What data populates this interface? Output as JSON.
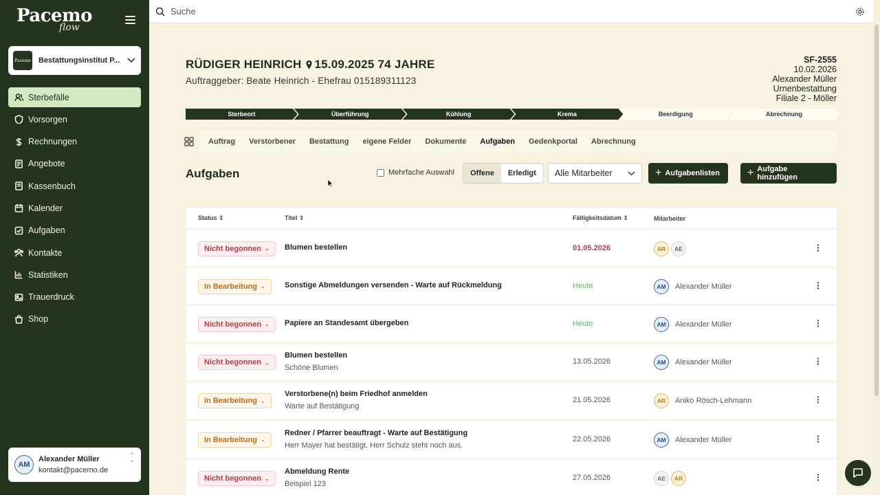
{
  "sidebar": {
    "brand": "Pacemo",
    "brand_sub": "flow",
    "org_logo": "Pacemo",
    "org_name": "Bestattungsinstitut P...",
    "items": [
      {
        "label": "Sterbefälle",
        "icon": "users-icon",
        "active": true
      },
      {
        "label": "Vorsorgen",
        "icon": "shield-icon"
      },
      {
        "label": "Rechnungen",
        "icon": "dollar-icon"
      },
      {
        "label": "Angebote",
        "icon": "document-icon"
      },
      {
        "label": "Kassenbuch",
        "icon": "book-icon"
      },
      {
        "label": "Kalender",
        "icon": "calendar-icon"
      },
      {
        "label": "Aufgaben",
        "icon": "checkbox-icon"
      },
      {
        "label": "Kontakte",
        "icon": "contacts-icon"
      },
      {
        "label": "Statistiken",
        "icon": "chart-icon"
      },
      {
        "label": "Trauerdruck",
        "icon": "image-icon"
      },
      {
        "label": "Shop",
        "icon": "shopping-bag-icon"
      }
    ],
    "user": {
      "initials": "AM",
      "name": "Alexander Müller",
      "email": "kontakt@pacemo.de"
    }
  },
  "search": {
    "placeholder": "Suche"
  },
  "case": {
    "name": "RÜDIGER HEINRICH",
    "date_age": "15.09.2025 74 JAHRE",
    "client": "Auftraggeber: Beate Heinrich - Ehefrau  015189311123",
    "id": "SF-2555",
    "date": "10.02.2026",
    "agent": "Alexander Müller",
    "type": "Urnenbestattung",
    "branch": "Filiale 2 - Möller"
  },
  "progress": [
    {
      "label": "Sterbeort",
      "done": true
    },
    {
      "label": "Überführung",
      "done": true
    },
    {
      "label": "Kühlung",
      "done": true
    },
    {
      "label": "Krema",
      "done": true
    },
    {
      "label": "Beerdigung",
      "done": false
    },
    {
      "label": "Abrechnung",
      "done": false
    }
  ],
  "tabs": [
    "Auftrag",
    "Verstorbener",
    "Bestattung",
    "eigene Felder",
    "Dokumente",
    "Aufgaben",
    "Gedenkportal",
    "Abrechnung"
  ],
  "active_tab": "Aufgaben",
  "tasks_section": {
    "title": "Aufgaben",
    "multi_select": "Mehrfache Auswahl",
    "filter_open": "Offene",
    "filter_done": "Erledigt",
    "staff_filter": "Alle Mitarbeiter",
    "btn_lists": "Aufgabenlisten",
    "btn_add": "Aufgabe hinzufügen"
  },
  "table": {
    "headers": {
      "status": "Status",
      "title": "Titel",
      "due": "Fälligkeitsdatum",
      "staff": "Mitarbeiter"
    },
    "rows": [
      {
        "status": "Nicht begonnen",
        "status_kind": "nb",
        "title": "Blumen bestellen",
        "desc": "",
        "due": "01.05.2026",
        "due_kind": "red",
        "avatars": [
          "AR",
          "AE"
        ],
        "staff_name": ""
      },
      {
        "status": "In Bearbeitung",
        "status_kind": "ib",
        "title": "Sonstige Abmeldungen versenden - Warte auf Rückmeldung",
        "desc": "",
        "due": "Heute",
        "due_kind": "green",
        "avatars": [
          "AM"
        ],
        "staff_name": "Alexander Müller"
      },
      {
        "status": "Nicht begonnen",
        "status_kind": "nb",
        "title": "Papiere an Standesamt übergeben",
        "desc": "",
        "due": "Heute",
        "due_kind": "green",
        "avatars": [
          "AM"
        ],
        "staff_name": "Alexander Müller"
      },
      {
        "status": "Nicht begonnen",
        "status_kind": "nb",
        "title": "Blumen bestellen",
        "desc": "Schöne Blumen",
        "due": "13.05.2026",
        "due_kind": "",
        "avatars": [
          "AM"
        ],
        "staff_name": "Alexander Müller"
      },
      {
        "status": "In Bearbeitung",
        "status_kind": "ib",
        "title": "Verstorbene(n) beim Friedhof anmelden",
        "desc": "Warte auf Bestätigung",
        "due": "21.05.2026",
        "due_kind": "",
        "avatars": [
          "AR"
        ],
        "staff_name": "Aniko Rösch-Lehmann"
      },
      {
        "status": "In Bearbeitung",
        "status_kind": "ib",
        "title": "Redner / Pfarrer beauftragt - Warte auf Bestätigung",
        "desc": "Herr Mayer hat bestätigt. Herr Schulz steht noch aus.",
        "due": "22.05.2026",
        "due_kind": "",
        "avatars": [
          "AM"
        ],
        "staff_name": "Alexander Müller"
      },
      {
        "status": "Nicht begonnen",
        "status_kind": "nb",
        "title": "Abmeldung Rente",
        "desc": "Beispiel 123",
        "due": "27.05.2026",
        "due_kind": "",
        "avatars": [
          "AE",
          "AR"
        ],
        "staff_name": ""
      }
    ]
  },
  "colors": {
    "sidebar": "#25341f",
    "accent_light": "#d5e7c2",
    "background": "#f7f3e0",
    "danger": "#b23b4b",
    "warning": "#c06b1d",
    "success": "#5cb56a"
  }
}
